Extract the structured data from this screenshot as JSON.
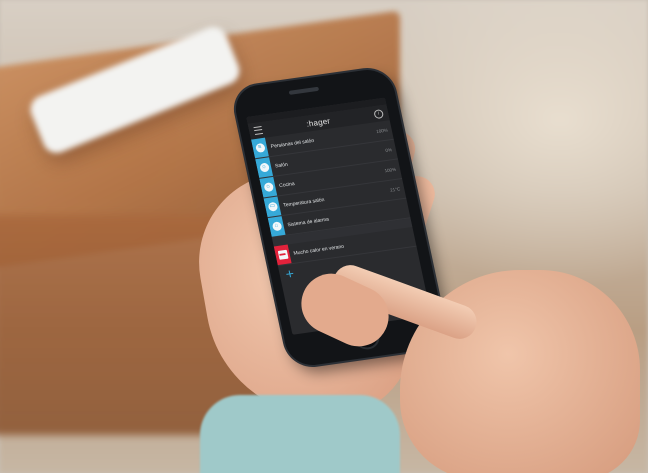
{
  "app": {
    "brand": ":hager",
    "info_glyph": "i",
    "add_glyph": "+"
  },
  "rows": [
    {
      "label": "Persianas del salón",
      "value": "100%",
      "icon": "blind-icon",
      "glyph": "≡",
      "accent": "#36a9d8"
    },
    {
      "label": "Salón",
      "value": "0%",
      "icon": "lamp-icon",
      "glyph": "☼",
      "accent": "#36a9d8"
    },
    {
      "label": "Cocina",
      "value": "100%",
      "icon": "lamp-icon",
      "glyph": "☼",
      "accent": "#36a9d8"
    },
    {
      "label": "Temperatura salón",
      "value": "21°C",
      "icon": "thermostat-icon",
      "glyph": "▭",
      "accent": "#36a9d8"
    },
    {
      "label": "Sistema de alarma",
      "value": "",
      "icon": "alarm-icon",
      "glyph": "⌂",
      "accent": "#36a9d8"
    },
    {
      "label": "Mucho calor en verano",
      "value": "",
      "icon": "scenario-icon",
      "glyph": "▬",
      "accent": "#e2223b"
    }
  ],
  "colors": {
    "accent_blue": "#36a9d8",
    "accent_red": "#e2223b",
    "screen_bg": "#2a2b2e"
  }
}
